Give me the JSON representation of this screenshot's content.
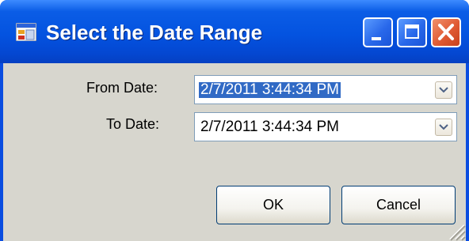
{
  "window": {
    "title": "Select the Date Range",
    "title_bar_color": "#0453e0",
    "icons": [
      "app-icon",
      "minimize-icon",
      "maximize-icon",
      "close-icon"
    ]
  },
  "form": {
    "from_label": "From Date:",
    "from_value": "2/7/2011 3:44:34 PM",
    "to_label": "To Date:",
    "to_value": "2/7/2011 3:44:34 PM",
    "dropdown_icon": "chevron-down-icon"
  },
  "buttons": {
    "ok_label": "OK",
    "cancel_label": "Cancel"
  }
}
